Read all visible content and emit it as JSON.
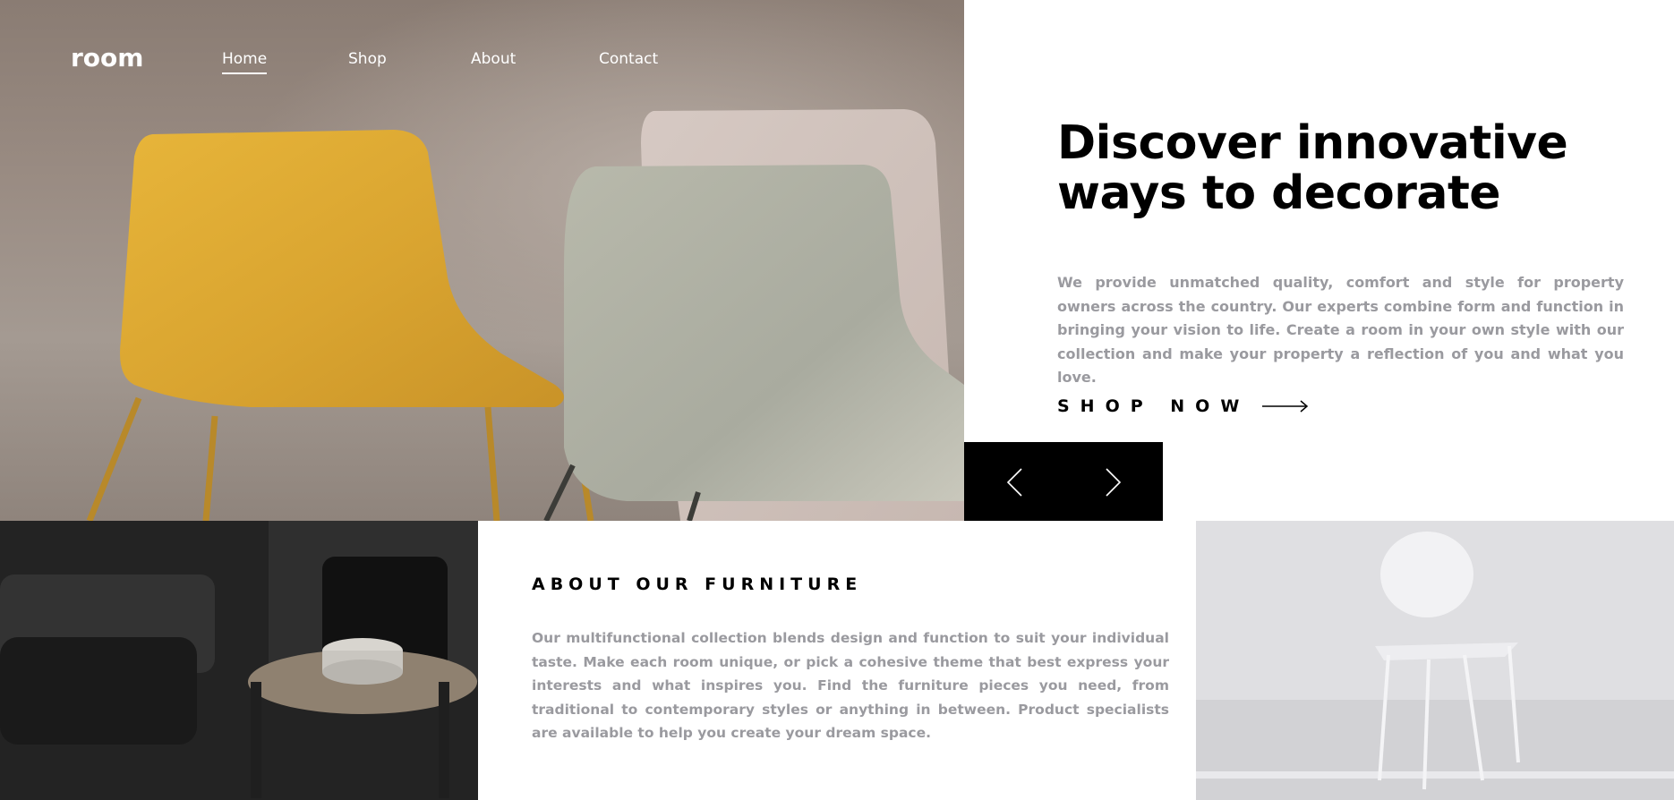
{
  "header": {
    "logo": "room",
    "nav": [
      {
        "label": "Home",
        "active": true
      },
      {
        "label": "Shop",
        "active": false
      },
      {
        "label": "About",
        "active": false
      },
      {
        "label": "Contact",
        "active": false
      }
    ]
  },
  "hero": {
    "title_line1": "Discover innovative",
    "title_line2": "ways to decorate",
    "description": "We provide unmatched quality, comfort and style for property owners across the country. Our experts combine form and function in bringing your vision to life. Create a room in your own style with our collection and make your property a reflection of you and what you love.",
    "cta_label": "SHOP NOW",
    "cta_icon": "arrow-right-icon"
  },
  "slider": {
    "prev_icon": "chevron-left-icon",
    "next_icon": "chevron-right-icon"
  },
  "about": {
    "title": "ABOUT OUR FURNITURE",
    "description": "Our multifunctional collection blends design and function to suit your individual taste. Make each room unique, or pick a cohesive theme that best express your interests and what inspires you. Find the furniture pieces you need, from traditional to contemporary styles or anything in between. Product specialists are available to help you create your dream space."
  },
  "colors": {
    "text_primary": "#000000",
    "text_muted": "#9a9a9f",
    "control_bg": "#000000"
  }
}
